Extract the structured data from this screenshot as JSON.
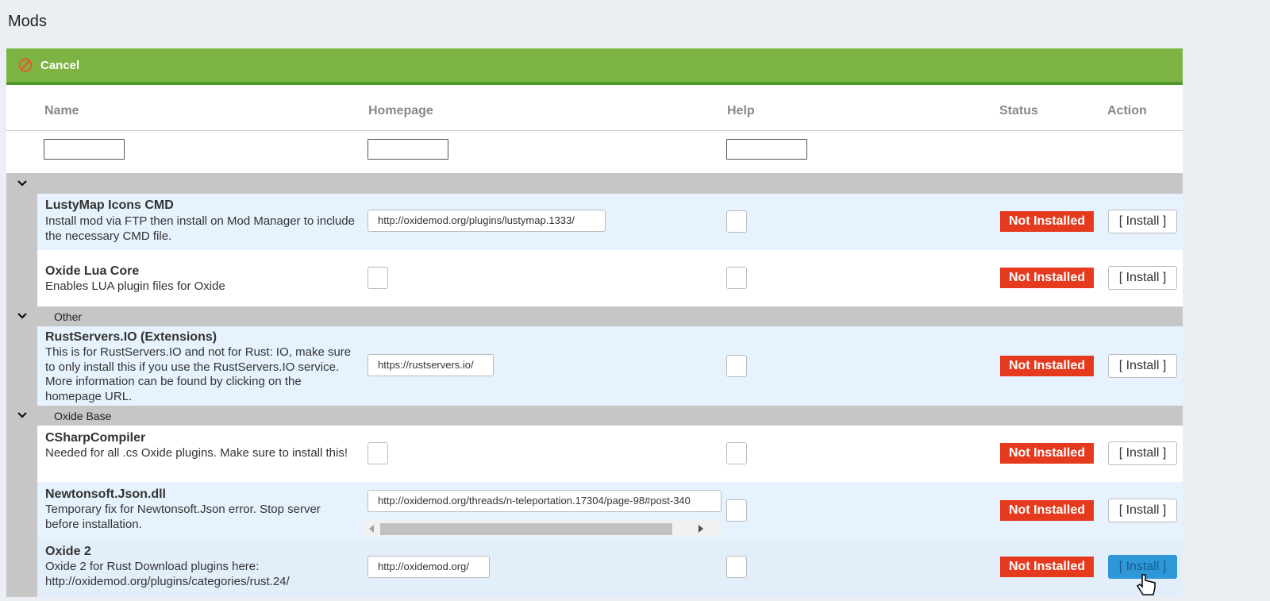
{
  "page": {
    "title": "Mods"
  },
  "toolbar": {
    "cancel_label": "Cancel",
    "accent": "#7cb342"
  },
  "columns": {
    "name": "Name",
    "homepage": "Homepage",
    "help": "Help",
    "status": "Status",
    "action": "Action"
  },
  "groups": [
    {
      "label": ""
    },
    {
      "label": "Other"
    },
    {
      "label": "Oxide Base"
    }
  ],
  "mods": [
    {
      "name": "LustyMap Icons CMD",
      "description": "Install mod via FTP then install on Mod Manager to include the necessary CMD file.",
      "homepage": "http://oxidemod.org/plugins/lustymap.1333/",
      "status": "Not Installed",
      "action": "[ Install ]"
    },
    {
      "name": "Oxide Lua Core",
      "description": "Enables LUA plugin files for Oxide",
      "homepage": "",
      "status": "Not Installed",
      "action": "[ Install ]"
    },
    {
      "name": "RustServers.IO (Extensions)",
      "description": "This is for RustServers.IO and not for Rust: IO, make sure to only install this if you use the RustServers.IO service. More information can be found by clicking on the homepage URL.",
      "homepage": "https://rustservers.io/",
      "status": "Not Installed",
      "action": "[ Install ]"
    },
    {
      "name": "CSharpCompiler",
      "description": "Needed for all .cs Oxide plugins. Make sure to install this!",
      "homepage": "",
      "status": "Not Installed",
      "action": "[ Install ]"
    },
    {
      "name": "Newtonsoft.Json.dll",
      "description": "Temporary fix for Newtonsoft.Json error. Stop server before installation.",
      "homepage": "http://oxidemod.org/threads/n-teleportation.17304/page-98#post-340",
      "status": "Not Installed",
      "action": "[ Install ]"
    },
    {
      "name": "Oxide 2",
      "description": "Oxide 2 for Rust Download plugins here: http://oxidemod.org/plugins/categories/rust.24/",
      "homepage": "http://oxidemod.org/",
      "status": "Not Installed",
      "action": "[ Install ]"
    }
  ],
  "colors": {
    "status_bg": "#e53a1d",
    "active_button": "#2d97d8",
    "group_bg": "#c6c6c6",
    "row_alt": "#e6f2fd"
  }
}
